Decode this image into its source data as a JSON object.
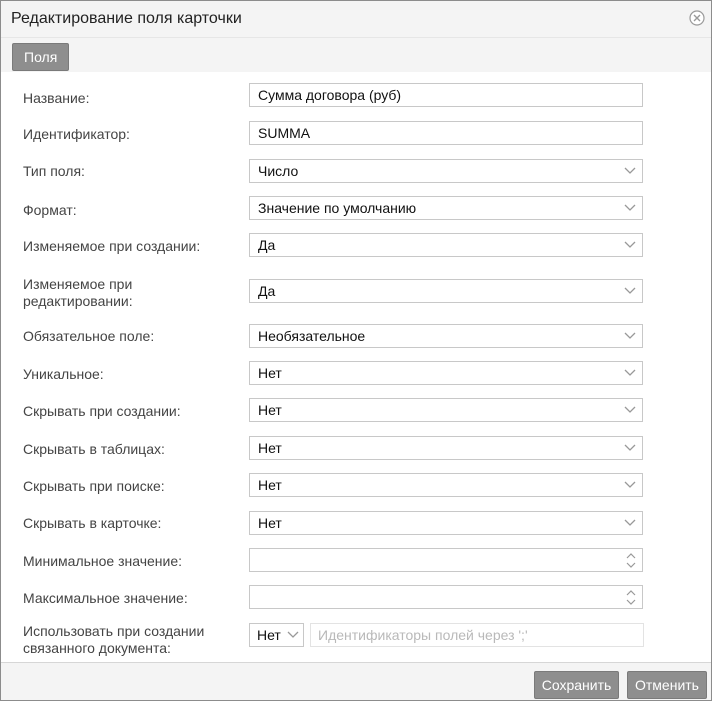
{
  "dialog": {
    "title": "Редактирование поля карточки",
    "close_icon": "close-circle-icon",
    "tab_label": "Поля"
  },
  "form": {
    "name": {
      "label": "Название:",
      "value": "Сумма договора (руб)"
    },
    "identifier": {
      "label": "Идентификатор:",
      "value": "SUMMA"
    },
    "field_type": {
      "label": "Тип поля:",
      "value": "Число"
    },
    "format": {
      "label": "Формат:",
      "value": "Значение по умолчанию"
    },
    "editable_on_create": {
      "label": "Изменяемое при создании:",
      "value": "Да"
    },
    "editable_on_edit": {
      "label_line1": "Изменяемое при",
      "label_line2": "редактировании:",
      "value": "Да"
    },
    "required": {
      "label": "Обязательное поле:",
      "value": "Необязательное"
    },
    "unique": {
      "label": "Уникальное:",
      "value": "Нет"
    },
    "hide_on_create": {
      "label": "Скрывать при создании:",
      "value": "Нет"
    },
    "hide_in_tables": {
      "label": "Скрывать в таблицах:",
      "value": "Нет"
    },
    "hide_in_search": {
      "label": "Скрывать при поиске:",
      "value": "Нет"
    },
    "hide_in_card": {
      "label": "Скрывать в карточке:",
      "value": "Нет"
    },
    "min_value": {
      "label": "Минимальное значение:",
      "value": ""
    },
    "max_value": {
      "label": "Максимальное значение:",
      "value": ""
    },
    "use_in_linked": {
      "label_line1": "Использовать при создании",
      "label_line2": "связанного документа:",
      "value": "Нет",
      "ids_placeholder": "Идентификаторы полей через ';'"
    }
  },
  "footer": {
    "save_label": "Сохранить",
    "cancel_label": "Отменить"
  }
}
